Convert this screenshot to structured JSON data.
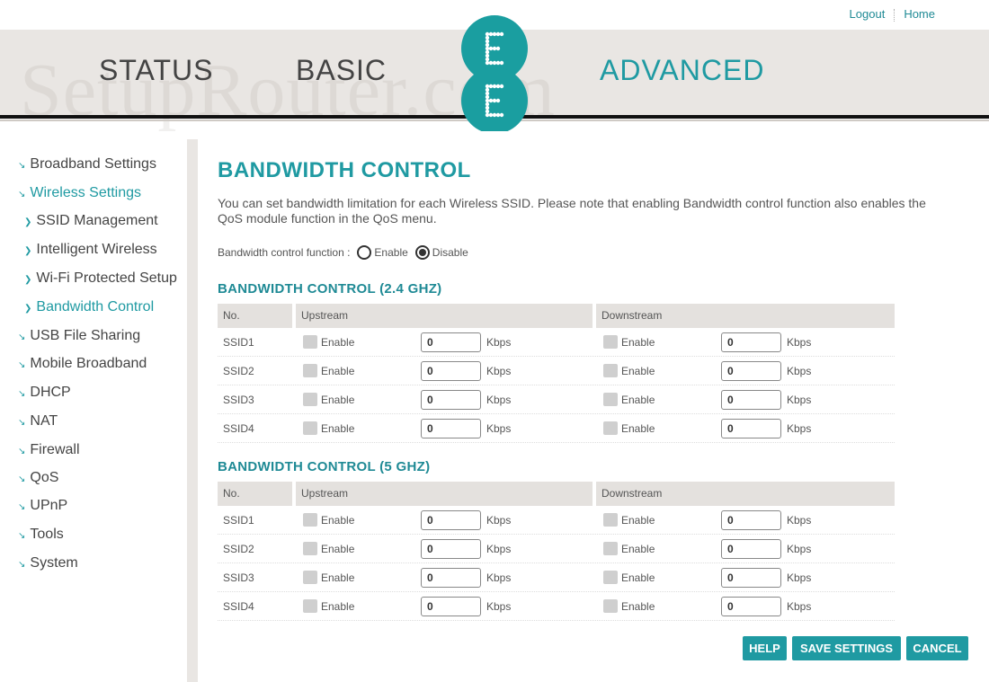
{
  "top_links": {
    "logout": "Logout",
    "home": "Home"
  },
  "watermark": "SetupRouter.com",
  "nav": {
    "status": "STATUS",
    "basic": "BASIC",
    "advanced": "ADVANCED"
  },
  "colors": {
    "accent": "#1f9aa2",
    "nav_bg": "#e9e6e3"
  },
  "sidebar": {
    "items": [
      {
        "label": "Broadband Settings"
      },
      {
        "label": "Wireless Settings"
      },
      {
        "label": "SSID Management"
      },
      {
        "label": "Intelligent Wireless"
      },
      {
        "label": "Wi-Fi Protected Setup"
      },
      {
        "label": "Bandwidth Control"
      },
      {
        "label": "USB File Sharing"
      },
      {
        "label": "Mobile Broadband"
      },
      {
        "label": "DHCP"
      },
      {
        "label": "NAT"
      },
      {
        "label": "Firewall"
      },
      {
        "label": "QoS"
      },
      {
        "label": "UPnP"
      },
      {
        "label": "Tools"
      },
      {
        "label": "System"
      }
    ]
  },
  "page": {
    "title": "BANDWIDTH CONTROL",
    "description": "You can set bandwidth limitation for each Wireless SSID. Please note that enabling Bandwidth control function also enables the QoS module function in the QoS menu.",
    "function_label": "Bandwidth control function :",
    "enable_label": "Enable",
    "disable_label": "Disable",
    "selected": "Disable"
  },
  "tables": [
    {
      "heading": "BANDWIDTH CONTROL (2.4 GHZ)",
      "headers": {
        "no": "No.",
        "up": "Upstream",
        "down": "Downstream"
      },
      "rows": [
        {
          "ssid": "SSID1",
          "up_enable": "Enable",
          "up_value": "0",
          "up_unit": "Kbps",
          "down_enable": "Enable",
          "down_value": "0",
          "down_unit": "Kbps"
        },
        {
          "ssid": "SSID2",
          "up_enable": "Enable",
          "up_value": "0",
          "up_unit": "Kbps",
          "down_enable": "Enable",
          "down_value": "0",
          "down_unit": "Kbps"
        },
        {
          "ssid": "SSID3",
          "up_enable": "Enable",
          "up_value": "0",
          "up_unit": "Kbps",
          "down_enable": "Enable",
          "down_value": "0",
          "down_unit": "Kbps"
        },
        {
          "ssid": "SSID4",
          "up_enable": "Enable",
          "up_value": "0",
          "up_unit": "Kbps",
          "down_enable": "Enable",
          "down_value": "0",
          "down_unit": "Kbps"
        }
      ]
    },
    {
      "heading": "BANDWIDTH CONTROL (5 GHZ)",
      "headers": {
        "no": "No.",
        "up": "Upstream",
        "down": "Downstream"
      },
      "rows": [
        {
          "ssid": "SSID1",
          "up_enable": "Enable",
          "up_value": "0",
          "up_unit": "Kbps",
          "down_enable": "Enable",
          "down_value": "0",
          "down_unit": "Kbps"
        },
        {
          "ssid": "SSID2",
          "up_enable": "Enable",
          "up_value": "0",
          "up_unit": "Kbps",
          "down_enable": "Enable",
          "down_value": "0",
          "down_unit": "Kbps"
        },
        {
          "ssid": "SSID3",
          "up_enable": "Enable",
          "up_value": "0",
          "up_unit": "Kbps",
          "down_enable": "Enable",
          "down_value": "0",
          "down_unit": "Kbps"
        },
        {
          "ssid": "SSID4",
          "up_enable": "Enable",
          "up_value": "0",
          "up_unit": "Kbps",
          "down_enable": "Enable",
          "down_value": "0",
          "down_unit": "Kbps"
        }
      ]
    }
  ],
  "buttons": {
    "help": "HELP",
    "save": "SAVE SETTINGS",
    "cancel": "CANCEL"
  }
}
